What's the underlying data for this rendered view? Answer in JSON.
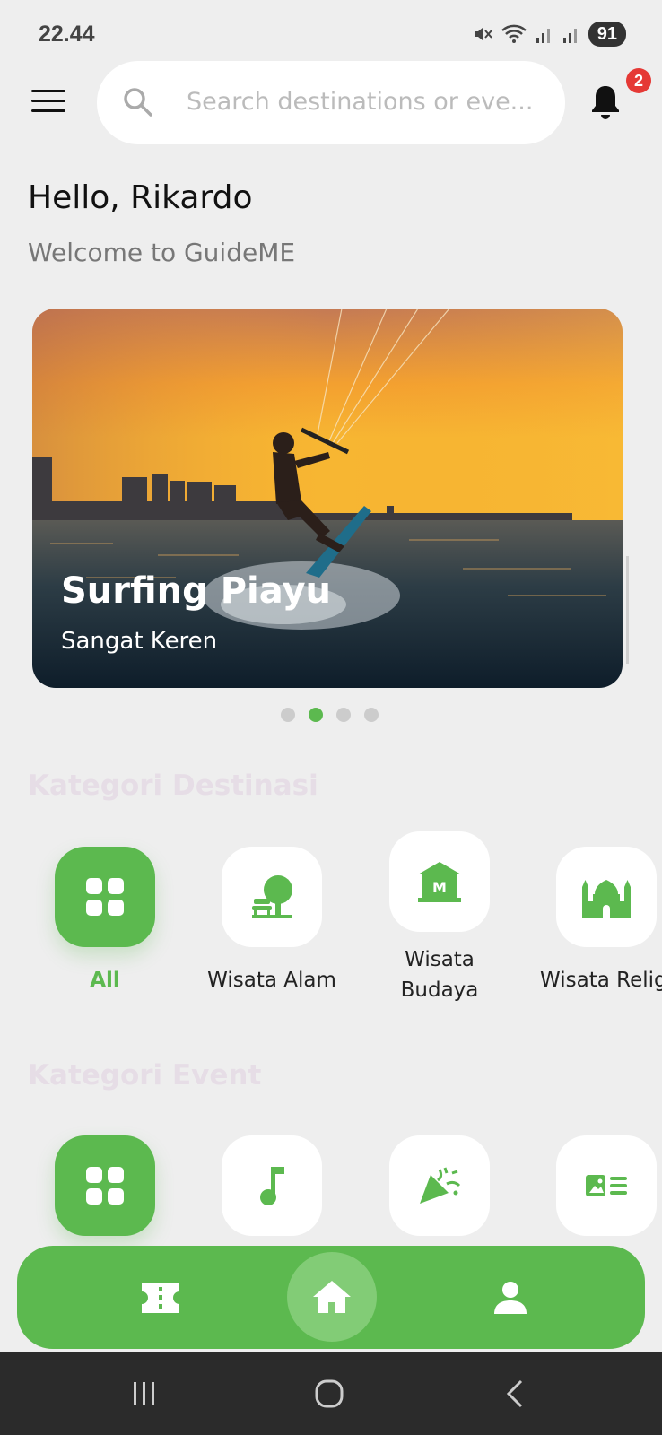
{
  "status_bar": {
    "time": "22.44",
    "battery": "91"
  },
  "header": {
    "search_placeholder": "Search destinations or eve...",
    "notification_count": "2"
  },
  "greeting": {
    "title": "Hello, Rikardo",
    "subtitle": "Welcome to GuideME"
  },
  "banner": {
    "title": "Surfing Piayu",
    "subtitle": "Sangat Keren",
    "active_slide": 2,
    "slide_count": 4
  },
  "destination_categories": {
    "title": "Kategori Destinasi",
    "items": [
      {
        "label": "All",
        "icon": "grid-icon",
        "active": true
      },
      {
        "label": "Wisata Alam",
        "icon": "tree-bench-icon"
      },
      {
        "label": "Wisata\nBudaya",
        "icon": "museum-icon"
      },
      {
        "label": "Wisata Religi",
        "icon": "mosque-icon"
      }
    ]
  },
  "event_categories": {
    "title": "Kategori Event",
    "items": [
      {
        "icon": "grid-icon",
        "active": true
      },
      {
        "icon": "music-note-icon"
      },
      {
        "icon": "party-popper-icon"
      },
      {
        "icon": "id-card-icon"
      }
    ]
  },
  "bottom_nav": {
    "items": [
      {
        "icon": "ticket-icon"
      },
      {
        "icon": "home-icon",
        "active": true
      },
      {
        "icon": "person-icon"
      }
    ]
  },
  "colors": {
    "accent": "#5cb94f",
    "badge": "#e53935",
    "background": "#eeeeee"
  }
}
